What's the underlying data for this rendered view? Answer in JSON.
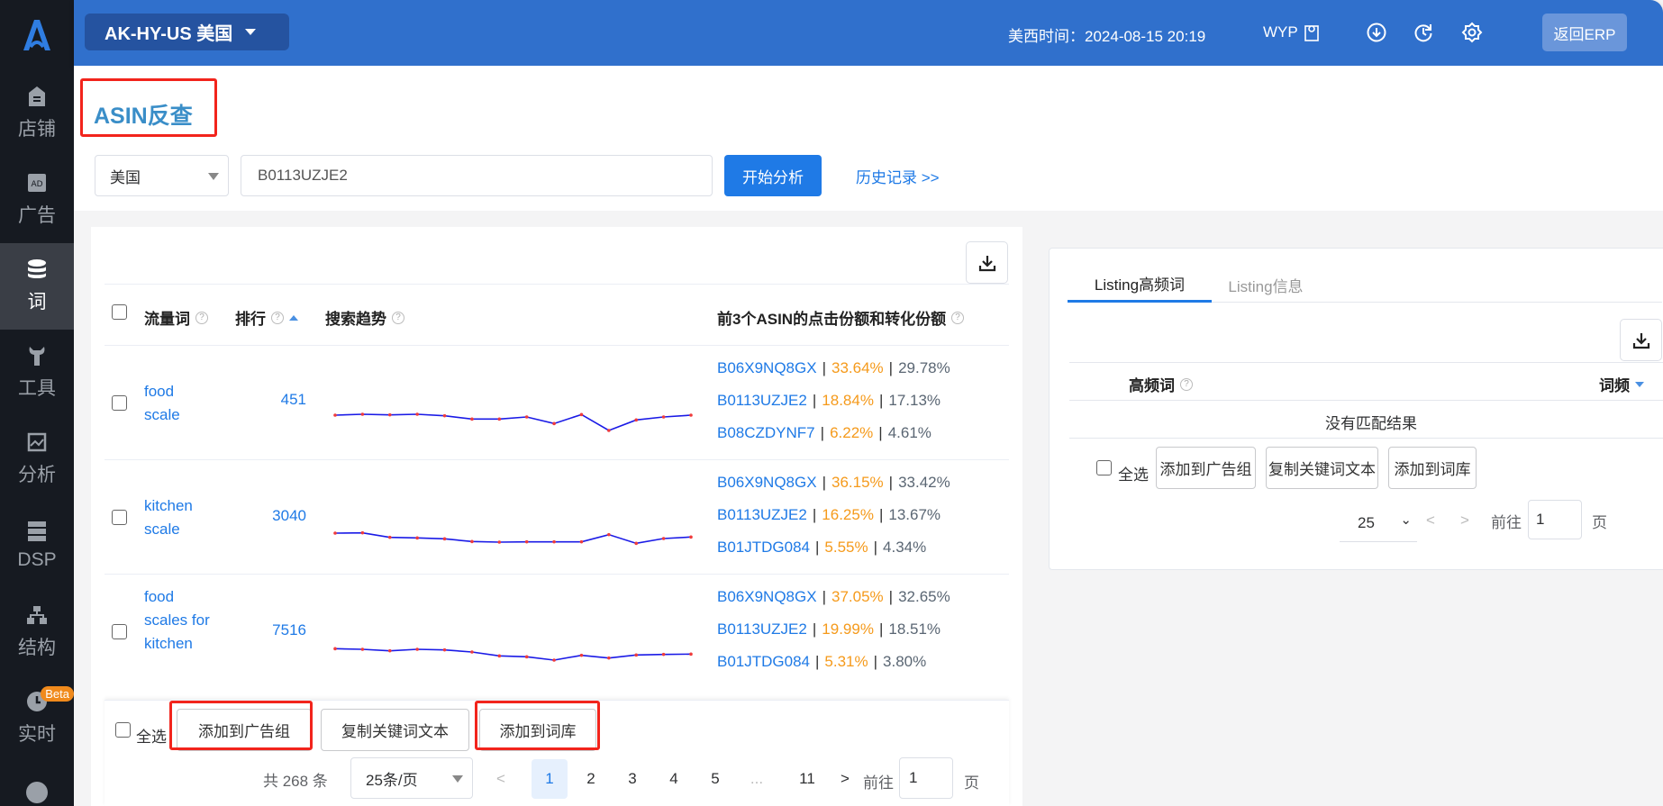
{
  "sidebar": {
    "items": [
      {
        "label": "店铺",
        "icon": "store-icon"
      },
      {
        "label": "广告",
        "icon": "ad-icon"
      },
      {
        "label": "词",
        "icon": "database-icon",
        "active": true
      },
      {
        "label": "工具",
        "icon": "wrench-icon"
      },
      {
        "label": "分析",
        "icon": "chart-icon"
      },
      {
        "label": "DSP",
        "icon": "server-icon"
      },
      {
        "label": "结构",
        "icon": "hierarchy-icon"
      },
      {
        "label": "实时",
        "icon": "clock-icon",
        "badge": "Beta"
      }
    ]
  },
  "topbar": {
    "store": "AK-HY-US 美国",
    "time_label": "美西时间：2024-08-15 20:19",
    "user": "WYP",
    "back_erp": "返回ERP",
    "color": "#3070cc"
  },
  "page": {
    "title": "ASIN反查"
  },
  "search": {
    "country": "美国",
    "asin": "B0113UZJE2",
    "analyze": "开始分析",
    "history": "历史记录 >>"
  },
  "table": {
    "headers": {
      "keyword": "流量词",
      "rank": "排行",
      "trend": "搜索趋势",
      "share": "前3个ASIN的点击份额和转化份额"
    },
    "rows": [
      {
        "keyword": "food scale",
        "rank": "451",
        "trend": [
          69,
          72,
          70,
          72,
          67,
          56,
          56,
          63,
          41,
          71,
          18,
          53,
          63,
          69
        ],
        "asins": [
          {
            "asin": "B06X9NQ8GX",
            "click": "33.64%",
            "conv": "29.78%"
          },
          {
            "asin": "B0113UZJE2",
            "click": "18.84%",
            "conv": "17.13%"
          },
          {
            "asin": "B08CZDYNF7",
            "click": "6.22%",
            "conv": "4.61%"
          }
        ]
      },
      {
        "keyword": "kitchen scale",
        "rank": "3040",
        "trend": [
          57,
          58,
          43,
          41,
          38,
          29,
          27,
          28,
          28,
          28,
          52,
          23,
          39,
          44
        ],
        "asins": [
          {
            "asin": "B06X9NQ8GX",
            "click": "36.15%",
            "conv": "33.42%"
          },
          {
            "asin": "B0113UZJE2",
            "click": "16.25%",
            "conv": "13.67%"
          },
          {
            "asin": "B01JTDG084",
            "click": "5.55%",
            "conv": "4.34%"
          }
        ]
      },
      {
        "keyword": "food scales for kitchen",
        "rank": "7516",
        "trend": [
          53,
          51,
          46,
          51,
          49,
          42,
          29,
          26,
          15,
          31,
          22,
          32,
          34,
          35
        ],
        "asins": [
          {
            "asin": "B06X9NQ8GX",
            "click": "37.05%",
            "conv": "32.65%"
          },
          {
            "asin": "B0113UZJE2",
            "click": "19.99%",
            "conv": "18.51%"
          },
          {
            "asin": "B01JTDG084",
            "click": "5.31%",
            "conv": "3.80%"
          }
        ]
      }
    ],
    "footer": {
      "select_all": "全选",
      "add_adgroup": "添加到广告组",
      "copy_text": "复制关键词文本",
      "add_lib": "添加到词库",
      "total": "共 268 条",
      "page_size": "25条/页",
      "pages": [
        "1",
        "2",
        "3",
        "4",
        "5",
        "...",
        "11"
      ],
      "prev": "<",
      "next": ">",
      "goto": "前往",
      "goto_value": "1",
      "page_unit": "页"
    }
  },
  "right": {
    "tabs": [
      "Listing高频词",
      "Listing信息"
    ],
    "headers": {
      "word": "高频词",
      "freq": "词频"
    },
    "empty": "没有匹配结果",
    "footer": {
      "select_all": "全选",
      "add_adgroup": "添加到广告组",
      "copy_text": "复制关键词文本",
      "add_lib": "添加到词库",
      "page_size": "25",
      "prev": "<",
      "next": ">",
      "goto": "前往",
      "goto_value": "1",
      "page_unit": "页"
    }
  }
}
